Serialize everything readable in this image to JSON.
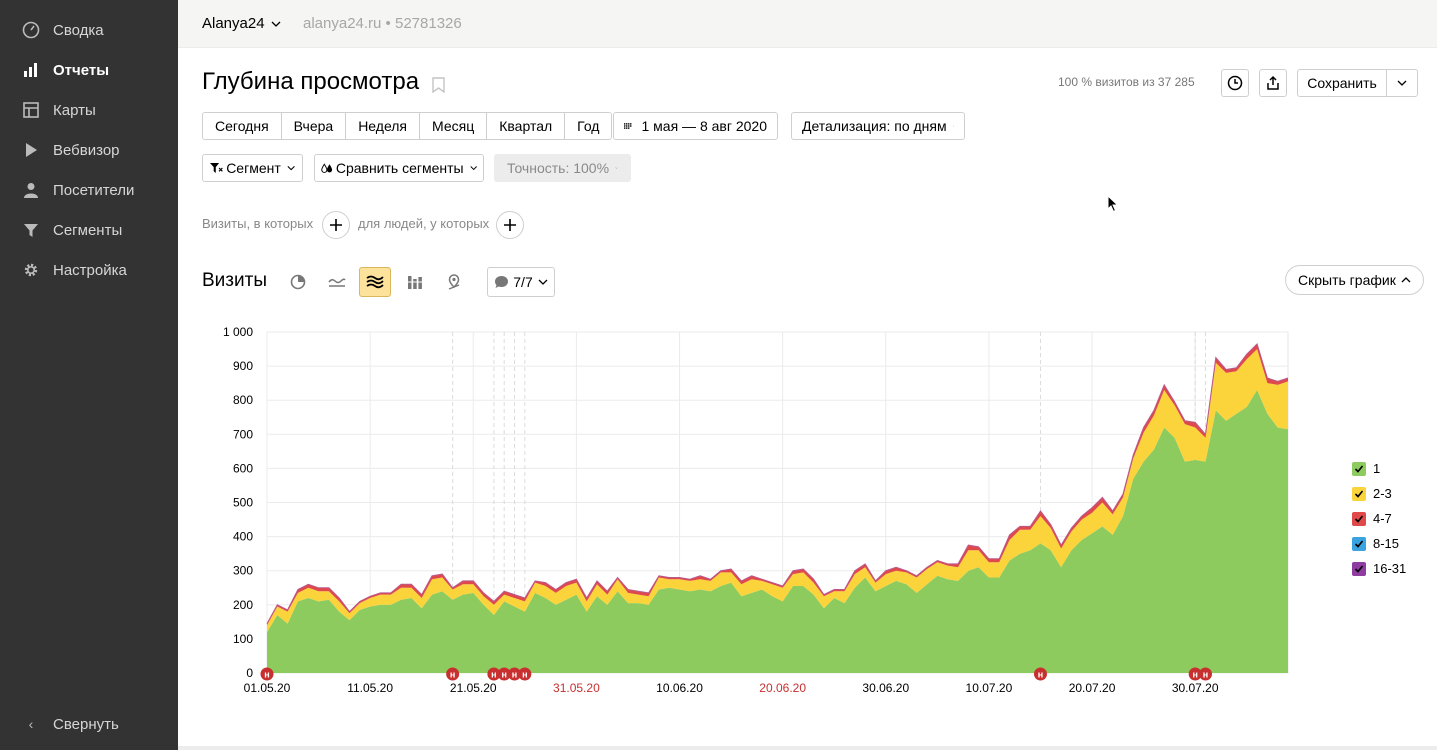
{
  "sidebar": {
    "items": [
      {
        "label": "Сводка",
        "icon": "dashboard-icon"
      },
      {
        "label": "Отчеты",
        "icon": "bar-chart-icon"
      },
      {
        "label": "Карты",
        "icon": "map-icon"
      },
      {
        "label": "Вебвизор",
        "icon": "play-icon"
      },
      {
        "label": "Посетители",
        "icon": "user-icon"
      },
      {
        "label": "Сегменты",
        "icon": "filter-icon"
      },
      {
        "label": "Настройка",
        "icon": "gear-icon"
      }
    ],
    "collapse_label": "Свернуть"
  },
  "header": {
    "counter_name": "Alanya24",
    "counter_site": "alanya24.ru • 52781326"
  },
  "main": {
    "title": "Глубина просмотра",
    "visits_info": "100 % визитов из 37 285",
    "save_label": "Сохранить",
    "periods": [
      "Сегодня",
      "Вчера",
      "Неделя",
      "Месяц",
      "Квартал",
      "Год"
    ],
    "date_range": "1 мая — 8 авг 2020",
    "detail": "Детализация: по дням",
    "segment": "Сегмент",
    "compare": "Сравнить сегменты",
    "accuracy": "Точность: 100%",
    "filter_visits": "Визиты, в которых",
    "filter_people": "для людей, у которых",
    "section_title": "Визиты",
    "notes_count": "7/7",
    "hide_chart": "Скрыть график"
  },
  "colors": {
    "sidebar_bg": "#333333",
    "series_1": "#8ecb5f",
    "series_2_3": "#fbd43c",
    "series_4_7": "#e0494a",
    "series_8_15": "#3aa3e0",
    "series_16_31": "#8e3ca0",
    "holiday_red": "#c7302f"
  },
  "chart_data": {
    "type": "area",
    "stacked": true,
    "x_start": "01.05.20",
    "x_tick_labels": [
      "01.05.20",
      "11.05.20",
      "21.05.20",
      "31.05.20",
      "10.06.20",
      "20.06.20",
      "30.06.20",
      "10.07.20",
      "20.07.20",
      "30.07.20"
    ],
    "x_tick_holiday": [
      false,
      false,
      false,
      true,
      false,
      true,
      false,
      false,
      false,
      false
    ],
    "ylim": [
      0,
      1000
    ],
    "y_ticks": [
      "0",
      "100",
      "200",
      "300",
      "400",
      "500",
      "600",
      "700",
      "800",
      "900",
      "1 000"
    ],
    "legend": [
      "1",
      "2-3",
      "4-7",
      "8-15",
      "16-31"
    ],
    "note_marker_label": "н",
    "note_days": [
      0,
      18,
      22,
      23,
      24,
      25,
      75,
      90,
      91
    ],
    "series": [
      {
        "name": "1",
        "values": [
          120,
          170,
          145,
          210,
          220,
          210,
          215,
          180,
          155,
          185,
          195,
          200,
          200,
          215,
          220,
          190,
          230,
          240,
          215,
          230,
          235,
          200,
          170,
          210,
          195,
          180,
          235,
          220,
          200,
          215,
          230,
          180,
          225,
          200,
          240,
          205,
          205,
          200,
          245,
          250,
          245,
          240,
          245,
          240,
          255,
          265,
          225,
          235,
          245,
          225,
          210,
          255,
          255,
          230,
          190,
          220,
          205,
          250,
          280,
          240,
          255,
          270,
          260,
          235,
          260,
          285,
          275,
          270,
          300,
          310,
          280,
          280,
          330,
          350,
          360,
          380,
          360,
          310,
          360,
          390,
          410,
          430,
          405,
          460,
          570,
          620,
          655,
          720,
          690,
          620,
          625,
          620,
          770,
          740,
          760,
          780,
          830,
          760,
          720,
          715
        ]
      },
      {
        "name": "2-3",
        "values": [
          20,
          25,
          35,
          25,
          30,
          30,
          25,
          30,
          20,
          20,
          25,
          30,
          30,
          35,
          30,
          30,
          45,
          40,
          30,
          30,
          25,
          25,
          30,
          20,
          25,
          30,
          30,
          35,
          35,
          40,
          35,
          30,
          35,
          30,
          35,
          30,
          25,
          25,
          35,
          25,
          30,
          30,
          30,
          30,
          40,
          30,
          35,
          40,
          25,
          35,
          40,
          35,
          40,
          35,
          35,
          20,
          35,
          40,
          30,
          25,
          35,
          30,
          35,
          45,
          45,
          40,
          40,
          40,
          60,
          50,
          45,
          45,
          60,
          70,
          60,
          80,
          65,
          55,
          55,
          60,
          60,
          70,
          60,
          55,
          60,
          85,
          100,
          110,
          95,
          110,
          95,
          70,
          140,
          140,
          125,
          140,
          120,
          90,
          125,
          140
        ]
      },
      {
        "name": "4-7",
        "values": [
          5,
          5,
          5,
          10,
          10,
          10,
          10,
          10,
          5,
          5,
          5,
          5,
          5,
          10,
          10,
          10,
          10,
          10,
          5,
          10,
          10,
          10,
          10,
          10,
          10,
          10,
          5,
          10,
          10,
          10,
          10,
          10,
          10,
          10,
          5,
          10,
          10,
          10,
          5,
          5,
          5,
          5,
          10,
          5,
          5,
          10,
          10,
          10,
          5,
          5,
          5,
          10,
          10,
          10,
          5,
          5,
          5,
          10,
          10,
          5,
          10,
          10,
          5,
          5,
          5,
          5,
          5,
          10,
          15,
          10,
          10,
          10,
          15,
          10,
          10,
          15,
          10,
          10,
          10,
          10,
          15,
          15,
          10,
          10,
          10,
          15,
          15,
          15,
          10,
          10,
          15,
          10,
          15,
          10,
          10,
          15,
          15,
          15,
          10,
          10
        ]
      },
      {
        "name": "8-15",
        "values": [
          0,
          0,
          0,
          0,
          0,
          0,
          0,
          0,
          0,
          0,
          0,
          0,
          0,
          0,
          0,
          0,
          0,
          0,
          0,
          0,
          0,
          0,
          0,
          0,
          0,
          0,
          0,
          0,
          0,
          0,
          0,
          0,
          0,
          0,
          0,
          0,
          0,
          0,
          0,
          0,
          0,
          0,
          0,
          0,
          0,
          0,
          0,
          0,
          0,
          0,
          0,
          0,
          0,
          0,
          0,
          0,
          0,
          0,
          0,
          0,
          0,
          0,
          0,
          0,
          0,
          0,
          0,
          0,
          0,
          0,
          0,
          0,
          0,
          0,
          0,
          0,
          0,
          0,
          0,
          0,
          0,
          0,
          0,
          0,
          0,
          0,
          0,
          0,
          0,
          0,
          0,
          0,
          0,
          0,
          0,
          0,
          0,
          0,
          0,
          0
        ]
      },
      {
        "name": "16-31",
        "values": [
          0,
          0,
          0,
          0,
          0,
          0,
          0,
          0,
          0,
          0,
          0,
          0,
          0,
          0,
          0,
          0,
          0,
          0,
          0,
          0,
          0,
          0,
          0,
          0,
          0,
          0,
          0,
          0,
          0,
          0,
          0,
          0,
          0,
          0,
          0,
          0,
          0,
          0,
          0,
          0,
          0,
          0,
          0,
          0,
          0,
          0,
          0,
          0,
          0,
          0,
          0,
          0,
          0,
          0,
          0,
          0,
          0,
          0,
          0,
          0,
          0,
          0,
          0,
          0,
          0,
          0,
          0,
          0,
          0,
          0,
          0,
          0,
          0,
          0,
          0,
          0,
          0,
          0,
          0,
          0,
          0,
          0,
          0,
          0,
          0,
          0,
          0,
          0,
          0,
          0,
          0,
          0,
          0,
          0,
          0,
          0,
          0,
          0,
          0,
          0
        ]
      }
    ]
  }
}
